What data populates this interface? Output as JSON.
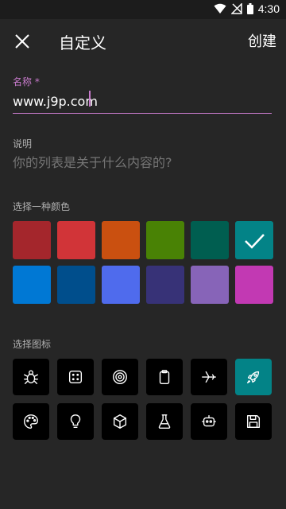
{
  "status": {
    "time": "4:30"
  },
  "header": {
    "title": "自定义",
    "create_label": "创建"
  },
  "name_field": {
    "label": "名称 *",
    "value": "www.j9p.com",
    "accent": "#c77acb"
  },
  "description_field": {
    "label": "说明",
    "placeholder": "你的列表是关于什么内容的?"
  },
  "colors": {
    "label": "选择一种颜色",
    "selected_index": 5,
    "swatches": [
      "#a4262c",
      "#d13438",
      "#ca5010",
      "#498205",
      "#005e50",
      "#038387",
      "#0078d4",
      "#004e8c",
      "#4f6bed",
      "#373277",
      "#8764b8",
      "#c239b3"
    ]
  },
  "icons": {
    "label": "选择图标",
    "selected_index": 5,
    "selected_bg": "#038387",
    "items": [
      "bug-icon",
      "dice-icon",
      "target-icon",
      "clipboard-icon",
      "airplane-icon",
      "rocket-icon",
      "palette-icon",
      "lightbulb-icon",
      "cube-icon",
      "flask-icon",
      "robot-icon",
      "floppy-disk-icon"
    ]
  }
}
